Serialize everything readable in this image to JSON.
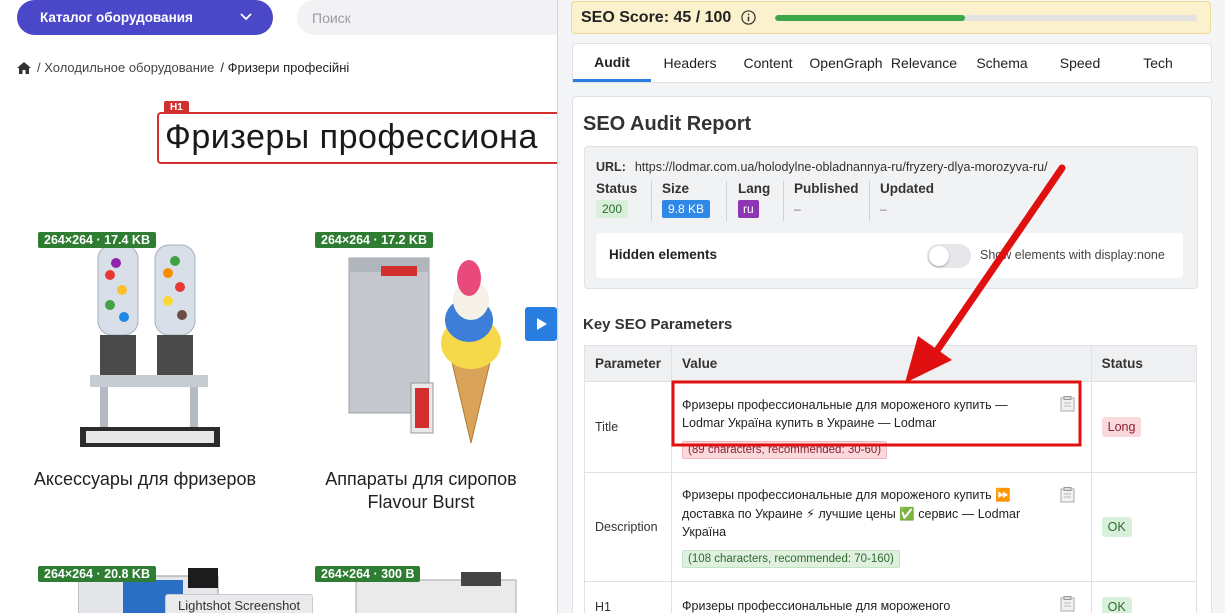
{
  "shop": {
    "catalog_button": "Каталог оборудования",
    "search_placeholder": "Поиск",
    "breadcrumb": {
      "items": [
        "/ Холодильное оборудование",
        "/ Фризери професійні"
      ]
    },
    "h1_tag": "H1",
    "h1_text": "Фризеры профессиона",
    "products": [
      {
        "badge": "264×264 · 17.4 KB",
        "title": "Аксессуары для фризеров"
      },
      {
        "badge": "264×264 · 17.2 KB",
        "title_line1": "Аппараты для сиропов",
        "title_line2": "Flavour Burst"
      },
      {
        "badge": "264×264 · 20.8 KB"
      },
      {
        "badge": "264×264 · 300 B"
      }
    ],
    "tooltip": "Lightshot Screenshot"
  },
  "panel": {
    "score_label": "SEO Score: 45 / 100",
    "score_value": 45,
    "score_max": 100,
    "tabs": [
      "Audit",
      "Headers",
      "Content",
      "OpenGraph",
      "Relevance",
      "Schema",
      "Speed",
      "Tech"
    ],
    "active_tab": "Audit",
    "report_title": "SEO Audit Report",
    "url_label": "URL:",
    "url": "https://lodmar.com.ua/holodylne-obladnannya-ru/fryzery-dlya-morozyva-ru/",
    "meta": {
      "status_label": "Status",
      "status_value": "200",
      "size_label": "Size",
      "size_value": "9.8 KB",
      "lang_label": "Lang",
      "lang_value": "ru",
      "published_label": "Published",
      "published_value": "–",
      "updated_label": "Updated",
      "updated_value": "–"
    },
    "hidden_label": "Hidden elements",
    "hidden_desc": "Show elements with display:none",
    "section_title": "Key SEO Parameters",
    "table_headers": [
      "Parameter",
      "Value",
      "Status"
    ],
    "rows": [
      {
        "param": "Title",
        "value": "Фризеры профессиональные для мороженого купить — Lodmar Україна купить в Украине — Lodmar",
        "count": "(89 characters, recommended: 30-60)",
        "status": "Long"
      },
      {
        "param": "Description",
        "value": "Фризеры профессиональные для мороженого купить ⏩ доставка по Украине ⚡ лучшие цены ✅ сервис — Lodmar Україна",
        "count": "(108 characters, recommended: 70-160)",
        "status": "OK"
      },
      {
        "param": "H1",
        "value": "Фризеры профессиональные для мороженого"
      }
    ]
  },
  "colors": {
    "brand": "#4a47c8",
    "accent": "#2a7de1",
    "score_bar": "#fbf2cd",
    "progress": "#3ba74b",
    "warn_red": "#d32f2f",
    "arrow": "#e01010"
  }
}
